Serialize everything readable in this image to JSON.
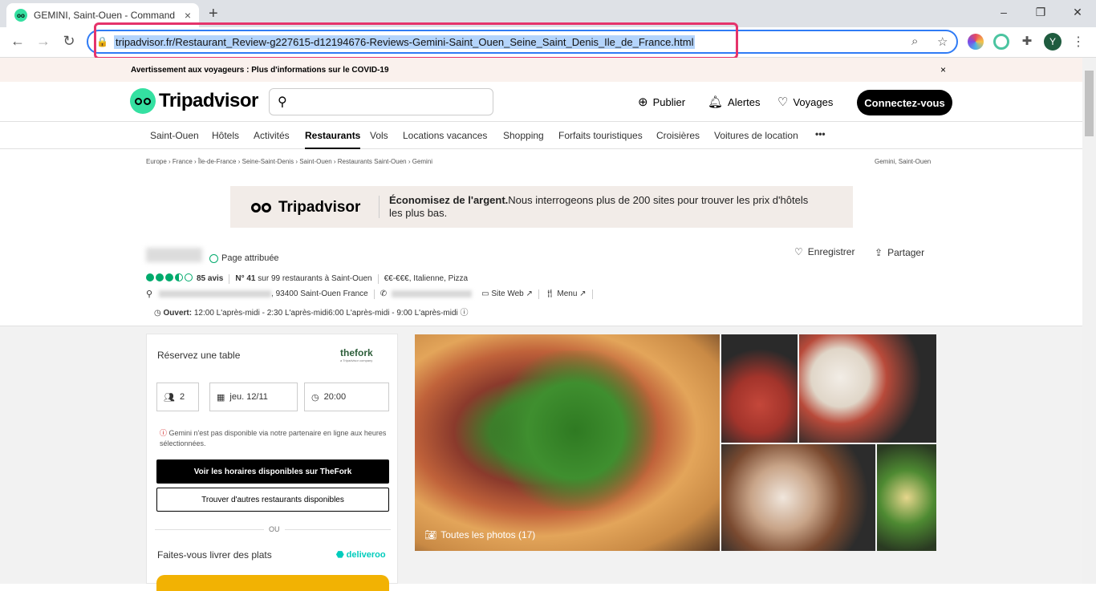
{
  "browser": {
    "tab_title": "GEMINI, Saint-Ouen - Command",
    "tab_close": "×",
    "new_tab": "+",
    "window_controls": {
      "minimize": "–",
      "restore": "❐",
      "close": "✕"
    },
    "nav": {
      "back": "←",
      "forward": "→",
      "reload": "↻"
    },
    "url": "tripadvisor.fr/Restaurant_Review-g227615-d12194676-Reviews-Gemini-Saint_Ouen_Seine_Saint_Denis_Ile_de_France.html",
    "profile_initial": "Y",
    "colors": {
      "omnibox_focus": "#2f7bf5",
      "highlight_box": "#e5336b",
      "url_selection": "#b4d4fb"
    }
  },
  "banner": {
    "text": "Avertissement aux voyageurs : Plus d'informations sur le COVID-19",
    "close": "×"
  },
  "header": {
    "logo": "Tripadvisor",
    "search_placeholder": "",
    "publish": "Publier",
    "alerts": "Alertes",
    "trips": "Voyages",
    "login": "Connectez-vous",
    "colors": {
      "brand": "#34e0a1"
    }
  },
  "subnav": {
    "items": [
      "Saint-Ouen",
      "Hôtels",
      "Activités",
      "Restaurants",
      "Vols",
      "Locations vacances",
      "Shopping",
      "Forfaits touristiques",
      "Croisières",
      "Voitures de location"
    ],
    "active": "Restaurants",
    "more": "•••"
  },
  "breadcrumb": {
    "items": [
      "Europe",
      "France",
      "Île-de-France",
      "Seine-Saint-Denis",
      "Saint-Ouen",
      "Restaurants Saint-Ouen",
      "Gemini"
    ],
    "right": "Gemini, Saint-Ouen"
  },
  "ad": {
    "logo": "Tripadvisor",
    "bold": "Économisez de l'argent.",
    "text": "Nous interrogeons plus de 200 sites pour trouver les prix d'hôtels les plus bas."
  },
  "restaurant": {
    "claimed": "Page attribuée",
    "save": "Enregistrer",
    "share": "Partager",
    "rating": 3.5,
    "reviews": "85 avis",
    "rank_bold": "N° 41",
    "rank_rest": "sur 99 restaurants à Saint-Ouen",
    "price_cuisine": "€€-€€€, Italienne, Pizza",
    "address_tail": ", 93400 Saint-Ouen France",
    "website": "Site Web",
    "menu": "Menu",
    "hours_label": "Ouvert:",
    "hours": "12:00 L'après-midi - 2:30 L'après-midi6:00 L'après-midi - 9:00 L'après-midi"
  },
  "booking": {
    "title": "Réservez une table",
    "partner": "thefork",
    "partner_sub": "a Tripadvisor company",
    "guests": "2",
    "date": "jeu. 12/11",
    "time": "20:00",
    "warning": "Gemini n'est pas disponible via notre partenaire en ligne aux heures sélectionnées.",
    "btn_fork": "Voir les horaires disponibles sur TheFork",
    "btn_other": "Trouver d'autres restaurants disponibles",
    "or": "OU",
    "delivery_title": "Faites-vous livrer des plats",
    "delivery_partner": "deliveroo"
  },
  "photos": {
    "all_label": "Toutes les photos (17)"
  }
}
